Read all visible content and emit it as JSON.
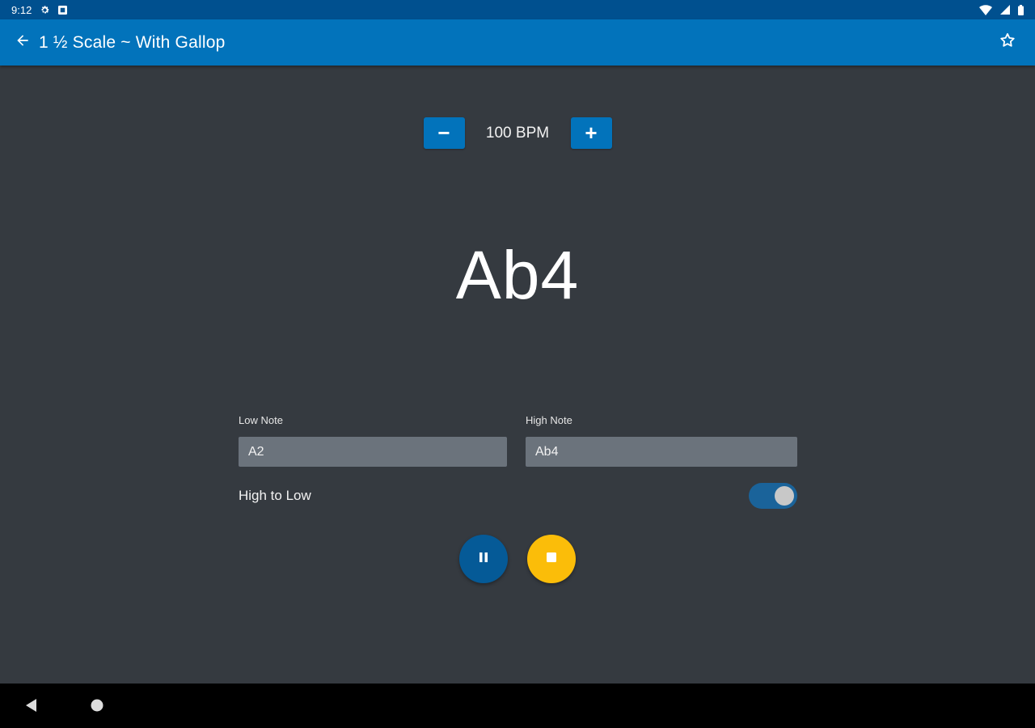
{
  "status_bar": {
    "time": "9:12",
    "icons": [
      "settings-icon",
      "notification-icon",
      "wifi-icon",
      "signal-icon",
      "battery-icon"
    ]
  },
  "app_bar": {
    "title": "1 ½ Scale ~ With Gallop",
    "back_icon": "arrow-left-icon",
    "favorite_icon": "star-outline-icon"
  },
  "tempo": {
    "decrement_label": "−",
    "value_label": "100 BPM",
    "increment_label": "+"
  },
  "current_note": "Ab4",
  "fields": {
    "low_note": {
      "label": "Low Note",
      "value": "A2"
    },
    "high_note": {
      "label": "High Note",
      "value": "Ab4"
    }
  },
  "direction_toggle": {
    "label": "High to Low",
    "checked": true
  },
  "controls": {
    "pause_icon": "pause-icon",
    "stop_icon": "stop-icon"
  },
  "nav_bar": {
    "icons": [
      "nav-back-icon",
      "nav-home-icon"
    ]
  },
  "colors": {
    "status_bar": "#00508f",
    "app_bar": "#0273bb",
    "background": "#353a40",
    "input_bg": "#6b737c",
    "pause_button": "#055a97",
    "stop_button": "#fbbd09",
    "switch_track": "#1a639a"
  }
}
